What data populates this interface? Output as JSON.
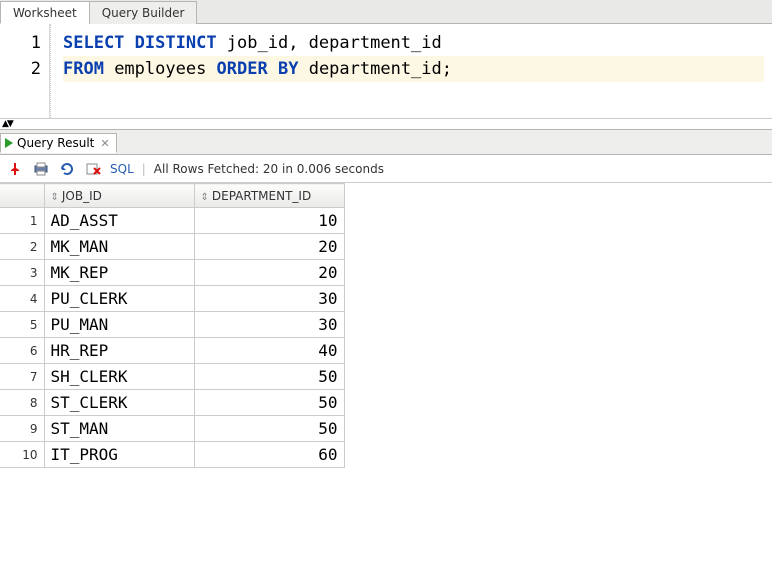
{
  "tabs": {
    "worksheet": "Worksheet",
    "query_builder": "Query Builder"
  },
  "editor": {
    "lines": [
      {
        "num": "1",
        "tokens": [
          {
            "t": "SELECT",
            "kw": true
          },
          {
            "t": " "
          },
          {
            "t": "DISTINCT",
            "kw": true
          },
          {
            "t": " job_id, department_id"
          }
        ],
        "hl": false
      },
      {
        "num": "2",
        "tokens": [
          {
            "t": "FROM",
            "kw": true
          },
          {
            "t": " employees "
          },
          {
            "t": "ORDER",
            "kw": true
          },
          {
            "t": " "
          },
          {
            "t": "BY",
            "kw": true
          },
          {
            "t": " department_id;"
          }
        ],
        "hl": true
      }
    ]
  },
  "result_tab": {
    "label": "Query Result"
  },
  "toolbar": {
    "sql_label": "SQL",
    "status": "All Rows Fetched: 20 in 0.006 seconds"
  },
  "grid": {
    "columns": [
      {
        "key": "job_id",
        "label": "JOB_ID"
      },
      {
        "key": "department_id",
        "label": "DEPARTMENT_ID"
      }
    ],
    "rows": [
      {
        "n": 1,
        "job_id": "AD_ASST",
        "department_id": 10
      },
      {
        "n": 2,
        "job_id": "MK_MAN",
        "department_id": 20
      },
      {
        "n": 3,
        "job_id": "MK_REP",
        "department_id": 20
      },
      {
        "n": 4,
        "job_id": "PU_CLERK",
        "department_id": 30
      },
      {
        "n": 5,
        "job_id": "PU_MAN",
        "department_id": 30
      },
      {
        "n": 6,
        "job_id": "HR_REP",
        "department_id": 40
      },
      {
        "n": 7,
        "job_id": "SH_CLERK",
        "department_id": 50
      },
      {
        "n": 8,
        "job_id": "ST_CLERK",
        "department_id": 50
      },
      {
        "n": 9,
        "job_id": "ST_MAN",
        "department_id": 50
      },
      {
        "n": 10,
        "job_id": "IT_PROG",
        "department_id": 60
      }
    ]
  }
}
